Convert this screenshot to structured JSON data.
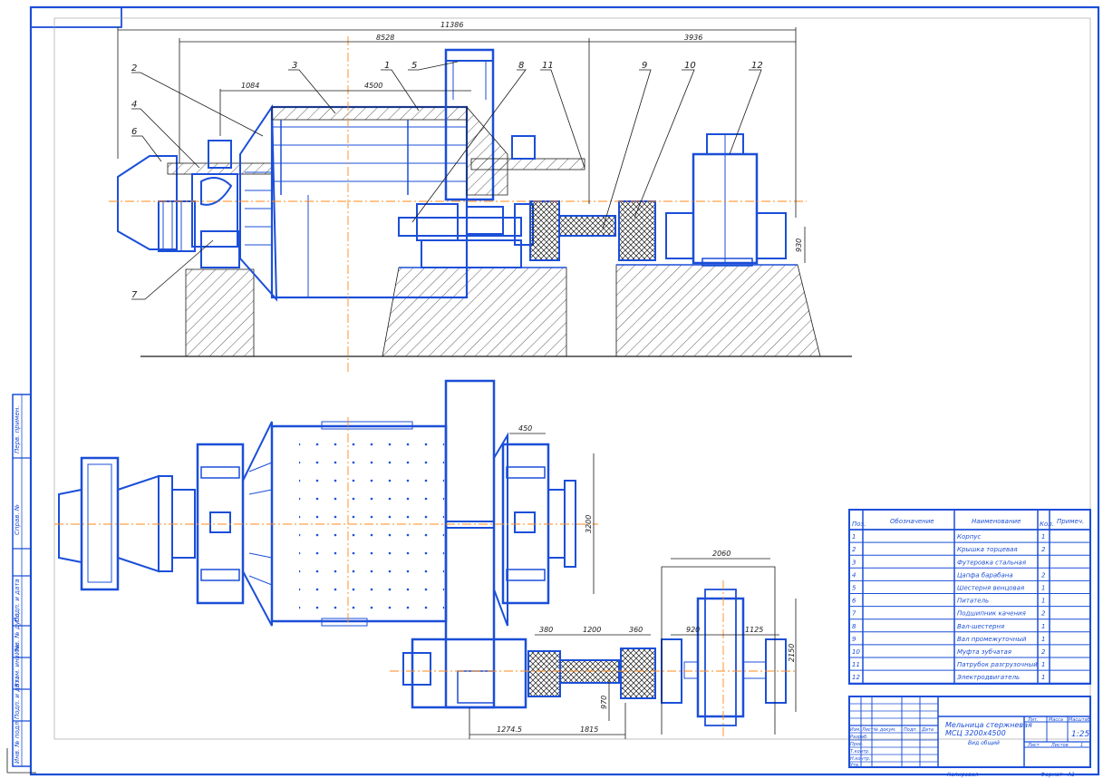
{
  "drawing": {
    "title_line1": "Мельница стержневая",
    "title_line2": "МСЦ 3200х4500",
    "title_line3": "Вид общий",
    "scale": "1:25",
    "sheet_label": "Лист",
    "sheets_label": "Листов",
    "sheets_count": "1",
    "mass_label": "Масса",
    "scale_label": "Масштаб",
    "lit_label": "Лит.",
    "copied_label": "Копировал",
    "format_label": "Формат",
    "format_value": "A1"
  },
  "dimensions": {
    "top_total": "11386",
    "top_left": "8528",
    "top_right": "3936",
    "d1084": "1084",
    "d4500": "4500",
    "d930_v": "930",
    "d450": "450",
    "d_vert_right": "3200",
    "d380": "380",
    "d1200": "1200",
    "d360": "360",
    "d2060": "2060",
    "d920": "920",
    "d1125": "1125",
    "d2150": "2150",
    "d970": "970",
    "d1274": "1274.5",
    "d1815": "1815"
  },
  "position_labels": [
    "1",
    "2",
    "3",
    "4",
    "5",
    "6",
    "7",
    "8",
    "9",
    "10",
    "11",
    "12"
  ],
  "spec_table": {
    "headers": [
      "Поз.",
      "Обозначение",
      "Наименование",
      "Кол.",
      "Примеч."
    ],
    "rows": [
      {
        "pos": "1",
        "name": "Корпус",
        "qty": "1"
      },
      {
        "pos": "2",
        "name": "Крышка торцевая",
        "qty": "2"
      },
      {
        "pos": "3",
        "name": "Футеровка стальная",
        "qty": ""
      },
      {
        "pos": "4",
        "name": "Цапфа барабана",
        "qty": "2"
      },
      {
        "pos": "5",
        "name": "Шестерня венцовая",
        "qty": "1"
      },
      {
        "pos": "6",
        "name": "Питатель",
        "qty": "1"
      },
      {
        "pos": "7",
        "name": "Подшипник качения",
        "qty": "2"
      },
      {
        "pos": "8",
        "name": "Вал-шестерня",
        "qty": "1"
      },
      {
        "pos": "9",
        "name": "Вал промежуточный",
        "qty": "1"
      },
      {
        "pos": "10",
        "name": "Муфта зубчатая",
        "qty": "2"
      },
      {
        "pos": "11",
        "name": "Патрубок разгрузочный",
        "qty": "1"
      },
      {
        "pos": "12",
        "name": "Электродвигатель",
        "qty": "1"
      }
    ]
  },
  "title_block_labels": {
    "izm": "Изм.",
    "list": "Лист",
    "ndok": "№ докум.",
    "podp": "Подп.",
    "data": "Дата",
    "razrab": "Разраб.",
    "prov": "Пров.",
    "tkontr": "Т.контр.",
    "nkontr": "Н.контр.",
    "utv": "Утв."
  },
  "left_strip": [
    "Перв. примен.",
    "Справ. №",
    "Подп. и дата",
    "Инв. № дубл.",
    "Взам. инв. №",
    "Подп. и дата",
    "Инв. № подл."
  ],
  "colors": {
    "outline": "#1b4fd8",
    "dimension": "#1a1a1a",
    "centerline": "#ff8a1a",
    "accent": "#e02020"
  }
}
